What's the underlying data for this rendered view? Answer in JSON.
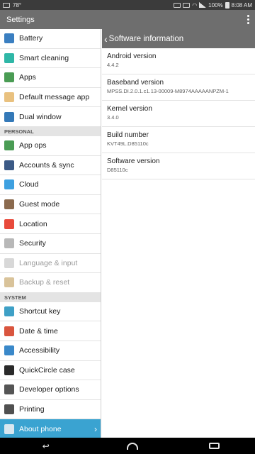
{
  "status": {
    "temperature": "78°",
    "battery": "100%",
    "time": "8:08 AM"
  },
  "app_bar": {
    "title": "Settings"
  },
  "left": {
    "items": [
      {
        "label": "Battery",
        "icon": "battery-icon",
        "color": "#3a7fc1"
      },
      {
        "label": "Smart cleaning",
        "icon": "smart-cleaning-icon",
        "color": "#2fb7a7"
      },
      {
        "label": "Apps",
        "icon": "apps-icon",
        "color": "#4a9c54"
      },
      {
        "label": "Default message app",
        "icon": "message-icon",
        "color": "#e9c17f"
      },
      {
        "label": "Dual window",
        "icon": "dual-window-icon",
        "color": "#3479b8"
      }
    ],
    "personal_header": "PERSONAL",
    "personal": [
      {
        "label": "App ops",
        "icon": "app-ops-icon",
        "color": "#4a9c54"
      },
      {
        "label": "Accounts & sync",
        "icon": "accounts-icon",
        "color": "#3b5a86"
      },
      {
        "label": "Cloud",
        "icon": "cloud-icon",
        "color": "#3ea0e0"
      },
      {
        "label": "Guest mode",
        "icon": "guest-mode-icon",
        "color": "#8b6a4e"
      },
      {
        "label": "Location",
        "icon": "location-icon",
        "color": "#e84a3b"
      },
      {
        "label": "Security",
        "icon": "lock-icon",
        "color": "#b8b8b8"
      },
      {
        "label": "Language & input",
        "icon": "language-icon",
        "color": "#d8d8d8",
        "disabled": true
      },
      {
        "label": "Backup & reset",
        "icon": "backup-icon",
        "color": "#d9c39a",
        "disabled": true
      }
    ],
    "system_header": "SYSTEM",
    "system": [
      {
        "label": "Shortcut key",
        "icon": "shortcut-key-icon",
        "color": "#3ea0c6"
      },
      {
        "label": "Date & time",
        "icon": "calendar-icon",
        "color": "#d9553e"
      },
      {
        "label": "Accessibility",
        "icon": "accessibility-icon",
        "color": "#3a88c9"
      },
      {
        "label": "QuickCircle case",
        "icon": "quickcircle-icon",
        "color": "#2a2a2a"
      },
      {
        "label": "Developer options",
        "icon": "developer-options-icon",
        "color": "#555555"
      },
      {
        "label": "Printing",
        "icon": "printer-icon",
        "color": "#505050"
      },
      {
        "label": "About phone",
        "icon": "about-phone-icon",
        "color": "#d8e7f0",
        "selected": true
      }
    ]
  },
  "detail": {
    "title": "Software information",
    "rows": [
      {
        "label": "Android version",
        "value": "4.4.2"
      },
      {
        "label": "Baseband version",
        "value": "MPSS.DI.2.0.1.c1.13-00009-M8974AAAAANPZM-1"
      },
      {
        "label": "Kernel version",
        "value": "3.4.0"
      },
      {
        "label": "Build number",
        "value": "KVT49L.D85110c"
      },
      {
        "label": "Software version",
        "value": "D85110c"
      }
    ]
  }
}
